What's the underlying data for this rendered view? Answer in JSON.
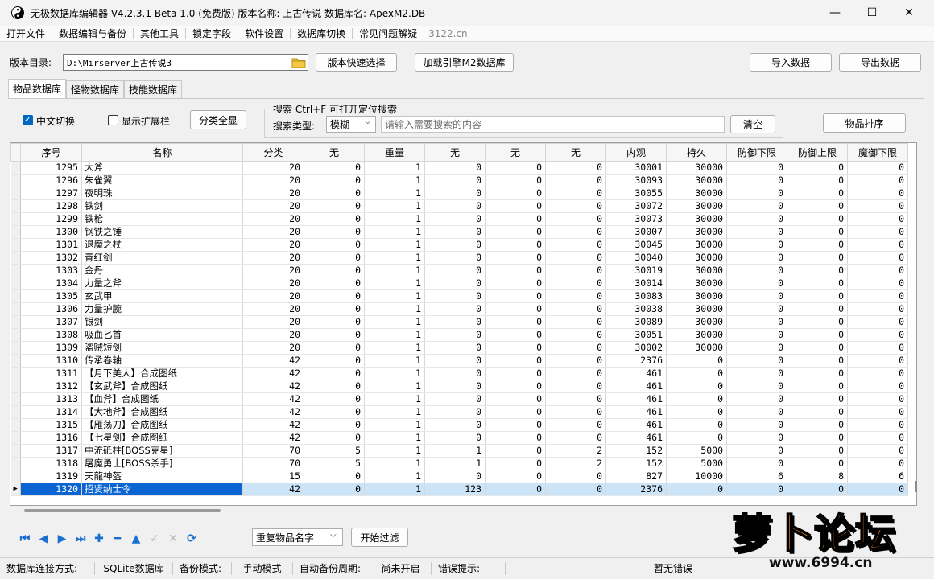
{
  "titlebar": {
    "title": "无极数据库编辑器 V4.2.3.1   Beta 1.0 (免费版)    版本名称: 上古传说    数据库名: ApexM2.DB",
    "minimize": "—",
    "maximize": "☐",
    "close": "✕"
  },
  "menu": {
    "items": [
      "打开文件",
      "数据编辑与备份",
      "其他工具",
      "锁定字段",
      "软件设置",
      "数据库切换",
      "常见问题解疑"
    ],
    "link": "3122.cn"
  },
  "toolbar": {
    "dir_label": "版本目录:",
    "dir_value": "D:\\Mirserver上古传说3",
    "quick_select": "版本快速选择",
    "load_m2": "加载引擎M2数据库",
    "import": "导入数据",
    "export": "导出数据"
  },
  "tabs": [
    "物品数据库",
    "怪物数据库",
    "技能数据库"
  ],
  "panel": {
    "chinese_toggle": "中文切换",
    "show_ext": "显示扩展栏",
    "category_all": "分类全显",
    "search_title": "搜索   Ctrl+F 可打开定位搜索",
    "search_type_label": "搜索类型:",
    "search_type_value": "模糊",
    "search_placeholder": "请输入需要搜索的内容",
    "clear": "清空",
    "sort": "物品排序"
  },
  "grid": {
    "columns": [
      "序号",
      "名称",
      "分类",
      "无",
      "重量",
      "无",
      "无",
      "无",
      "内观",
      "持久",
      "防御下限",
      "防御上限",
      "魔御下限"
    ],
    "rows": [
      [
        "1295",
        "大斧",
        "20",
        "0",
        "1",
        "0",
        "0",
        "0",
        "30001",
        "30000",
        "0",
        "0",
        "0"
      ],
      [
        "1296",
        "朱雀翼",
        "20",
        "0",
        "1",
        "0",
        "0",
        "0",
        "30093",
        "30000",
        "0",
        "0",
        "0"
      ],
      [
        "1297",
        "夜明珠",
        "20",
        "0",
        "1",
        "0",
        "0",
        "0",
        "30055",
        "30000",
        "0",
        "0",
        "0"
      ],
      [
        "1298",
        "铁剑",
        "20",
        "0",
        "1",
        "0",
        "0",
        "0",
        "30072",
        "30000",
        "0",
        "0",
        "0"
      ],
      [
        "1299",
        "铁枪",
        "20",
        "0",
        "1",
        "0",
        "0",
        "0",
        "30073",
        "30000",
        "0",
        "0",
        "0"
      ],
      [
        "1300",
        "钢铁之锤",
        "20",
        "0",
        "1",
        "0",
        "0",
        "0",
        "30007",
        "30000",
        "0",
        "0",
        "0"
      ],
      [
        "1301",
        "退魔之杖",
        "20",
        "0",
        "1",
        "0",
        "0",
        "0",
        "30045",
        "30000",
        "0",
        "0",
        "0"
      ],
      [
        "1302",
        "青红剑",
        "20",
        "0",
        "1",
        "0",
        "0",
        "0",
        "30040",
        "30000",
        "0",
        "0",
        "0"
      ],
      [
        "1303",
        "金丹",
        "20",
        "0",
        "1",
        "0",
        "0",
        "0",
        "30019",
        "30000",
        "0",
        "0",
        "0"
      ],
      [
        "1304",
        "力量之斧",
        "20",
        "0",
        "1",
        "0",
        "0",
        "0",
        "30014",
        "30000",
        "0",
        "0",
        "0"
      ],
      [
        "1305",
        "玄武甲",
        "20",
        "0",
        "1",
        "0",
        "0",
        "0",
        "30083",
        "30000",
        "0",
        "0",
        "0"
      ],
      [
        "1306",
        "力量护腕",
        "20",
        "0",
        "1",
        "0",
        "0",
        "0",
        "30038",
        "30000",
        "0",
        "0",
        "0"
      ],
      [
        "1307",
        "银剑",
        "20",
        "0",
        "1",
        "0",
        "0",
        "0",
        "30089",
        "30000",
        "0",
        "0",
        "0"
      ],
      [
        "1308",
        "吸血匕首",
        "20",
        "0",
        "1",
        "0",
        "0",
        "0",
        "30051",
        "30000",
        "0",
        "0",
        "0"
      ],
      [
        "1309",
        "盗贼短剑",
        "20",
        "0",
        "1",
        "0",
        "0",
        "0",
        "30002",
        "30000",
        "0",
        "0",
        "0"
      ],
      [
        "1310",
        "传承卷轴",
        "42",
        "0",
        "1",
        "0",
        "0",
        "0",
        "2376",
        "0",
        "0",
        "0",
        "0"
      ],
      [
        "1311",
        "【月下美人】合成图纸",
        "42",
        "0",
        "1",
        "0",
        "0",
        "0",
        "461",
        "0",
        "0",
        "0",
        "0"
      ],
      [
        "1312",
        "【玄武斧】合成图纸",
        "42",
        "0",
        "1",
        "0",
        "0",
        "0",
        "461",
        "0",
        "0",
        "0",
        "0"
      ],
      [
        "1313",
        "【血斧】合成图纸",
        "42",
        "0",
        "1",
        "0",
        "0",
        "0",
        "461",
        "0",
        "0",
        "0",
        "0"
      ],
      [
        "1314",
        "【大地斧】合成图纸",
        "42",
        "0",
        "1",
        "0",
        "0",
        "0",
        "461",
        "0",
        "0",
        "0",
        "0"
      ],
      [
        "1315",
        "【雁荡刀】合成图纸",
        "42",
        "0",
        "1",
        "0",
        "0",
        "0",
        "461",
        "0",
        "0",
        "0",
        "0"
      ],
      [
        "1316",
        "【七星剑】合成图纸",
        "42",
        "0",
        "1",
        "0",
        "0",
        "0",
        "461",
        "0",
        "0",
        "0",
        "0"
      ],
      [
        "1317",
        "中流砥柱[BOSS克星]",
        "70",
        "5",
        "1",
        "1",
        "0",
        "2",
        "152",
        "5000",
        "0",
        "0",
        "0"
      ],
      [
        "1318",
        "屠魔勇士[BOSS杀手]",
        "70",
        "5",
        "1",
        "1",
        "0",
        "2",
        "152",
        "5000",
        "0",
        "0",
        "0"
      ],
      [
        "1319",
        "天龍神盔",
        "15",
        "0",
        "1",
        "0",
        "0",
        "0",
        "827",
        "10000",
        "6",
        "8",
        "6"
      ],
      [
        "1320",
        "招贤纳士令",
        "42",
        "0",
        "1",
        "123",
        "0",
        "0",
        "2376",
        "0",
        "0",
        "0",
        "0"
      ]
    ]
  },
  "filter": {
    "dropdown_value": "重复物品名字",
    "start_button": "开始过滤"
  },
  "status": {
    "conn_label": "数据库连接方式:",
    "conn_value": "SQLite数据库",
    "backup_label": "备份模式:",
    "backup_value": "手动模式",
    "auto_label": "自动备份周期:",
    "auto_value": "尚未开启",
    "error_label": "错误提示:",
    "error_value": "暂无错误"
  },
  "watermark": {
    "logo_text": "萝卜论坛",
    "url": "www.6994.cn"
  }
}
